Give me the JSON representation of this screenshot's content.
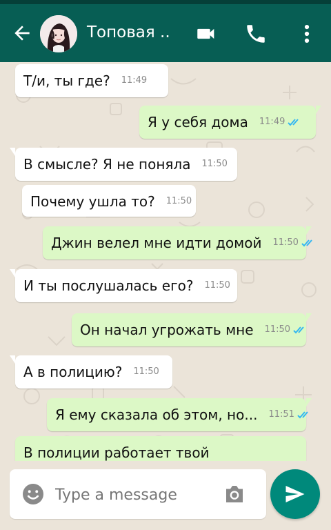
{
  "header": {
    "title": "Топовая ..",
    "back_icon": "arrow-left-icon",
    "video_icon": "video-call-icon",
    "call_icon": "phone-icon",
    "menu_icon": "more-vertical-icon"
  },
  "messages": [
    {
      "direction": "in",
      "text": "Т/и, ты где?",
      "time": "11:49"
    },
    {
      "direction": "out",
      "text": "Я у себя дома",
      "time": "11:49"
    },
    {
      "direction": "in",
      "text": "В смысле? Я не поняла",
      "time": "11:50"
    },
    {
      "direction": "in",
      "text": "Почему ушла то?",
      "time": "11:50"
    },
    {
      "direction": "out",
      "text": "Джин велел мне идти домой",
      "time": "11:50"
    },
    {
      "direction": "in",
      "text": "И ты послушалась его?",
      "time": "11:50"
    },
    {
      "direction": "out",
      "text": "Он начал угрожать мне",
      "time": "11:50"
    },
    {
      "direction": "in",
      "text": "А в полицию?",
      "time": "11:50"
    },
    {
      "direction": "out",
      "text": "Я ему сказала об этом, но...",
      "time": "11:51"
    },
    {
      "direction": "out",
      "text": "В полиции  работает твой",
      "time": ""
    }
  ],
  "composer": {
    "placeholder": "Type a message",
    "emoji_icon": "emoji-icon",
    "camera_icon": "camera-icon",
    "send_icon": "send-icon"
  },
  "colors": {
    "header": "#075e54",
    "incoming": "#ffffff",
    "outgoing": "#dcf8c6",
    "send": "#00897b",
    "tick": "#34b7f1"
  }
}
